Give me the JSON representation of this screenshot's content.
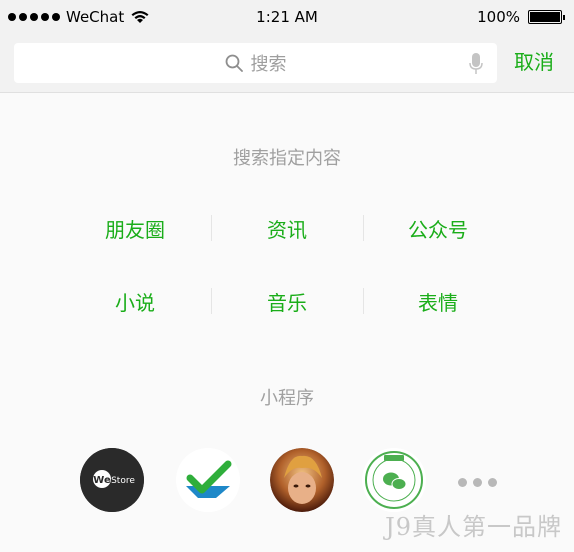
{
  "status": {
    "carrier": "WeChat",
    "time": "1:21 AM",
    "battery": "100%",
    "battery_level": 1.0
  },
  "search": {
    "placeholder": "搜索",
    "cancel_label": "取消"
  },
  "sections": {
    "specified_title": "搜索指定内容",
    "categories": [
      "朋友圈",
      "资讯",
      "公众号",
      "小说",
      "音乐",
      "表情"
    ],
    "miniprogram_title": "小程序"
  },
  "miniprograms": {
    "westore_text": "WeStore",
    "icons": [
      "westore-icon",
      "checkmark-app-icon",
      "game-hero-icon",
      "wechat-open-class-icon",
      "more-icon"
    ]
  },
  "watermark": "J9真人第一品牌",
  "colors": {
    "accent": "#1aad19",
    "placeholder": "#9e9e9e",
    "section_title": "#a0a0a0"
  }
}
